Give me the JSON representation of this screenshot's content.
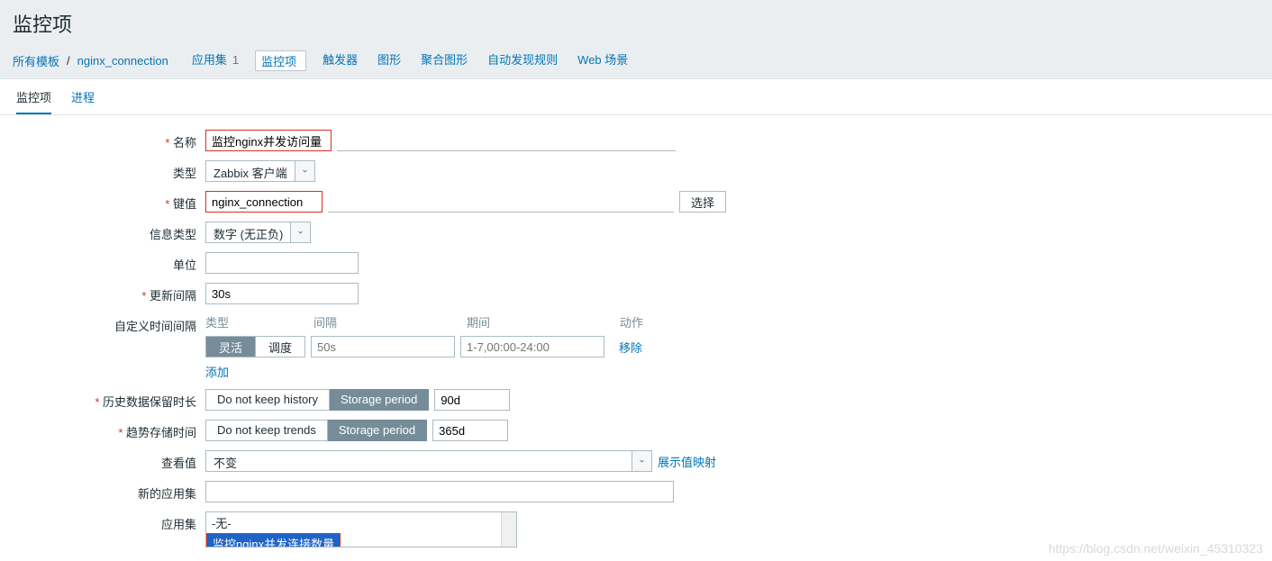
{
  "header": {
    "title": "监控项",
    "breadcrumb": {
      "all_templates": "所有模板",
      "template_name": "nginx_connection"
    },
    "nav": {
      "app_sets": "应用集",
      "app_sets_count": "1",
      "items": "监控项",
      "triggers": "触发器",
      "graphs": "图形",
      "screens": "聚合图形",
      "discovery": "自动发现规则",
      "web": "Web 场景"
    }
  },
  "sub_tabs": {
    "items": "监控项",
    "process": "进程"
  },
  "form": {
    "name_label": "名称",
    "name_value": "监控nginx并发访问量",
    "type_label": "类型",
    "type_value": "Zabbix 客户端",
    "key_label": "键值",
    "key_value": "nginx_connection",
    "select_btn": "选择",
    "info_type_label": "信息类型",
    "info_type_value": "数字 (无正负)",
    "unit_label": "单位",
    "unit_value": "",
    "update_interval_label": "更新间隔",
    "update_interval_value": "30s",
    "custom_interval_label": "自定义时间间隔",
    "interval_head": {
      "type": "类型",
      "interval": "间隔",
      "period": "期间",
      "action": "动作"
    },
    "interval_row": {
      "flex_on": "灵活",
      "flex_off": "调度",
      "interval_ph": "50s",
      "period_ph": "1-7,00:00-24:00",
      "remove": "移除"
    },
    "add_link": "添加",
    "history_label": "历史数据保留时长",
    "history_opt1": "Do not keep history",
    "history_opt2": "Storage period",
    "history_value": "90d",
    "trend_label": "趋势存储时间",
    "trend_opt1": "Do not keep trends",
    "trend_opt2": "Storage period",
    "trend_value": "365d",
    "viewvalue_label": "查看值",
    "viewvalue_value": "不变",
    "viewvalue_link": "展示值映射",
    "new_app_label": "新的应用集",
    "new_app_value": "",
    "app_label": "应用集",
    "app_opt_none": "-无-",
    "app_opt_selected": "监控nginx并发连接数量"
  },
  "watermark": "https://blog.csdn.net/weixin_45310323"
}
